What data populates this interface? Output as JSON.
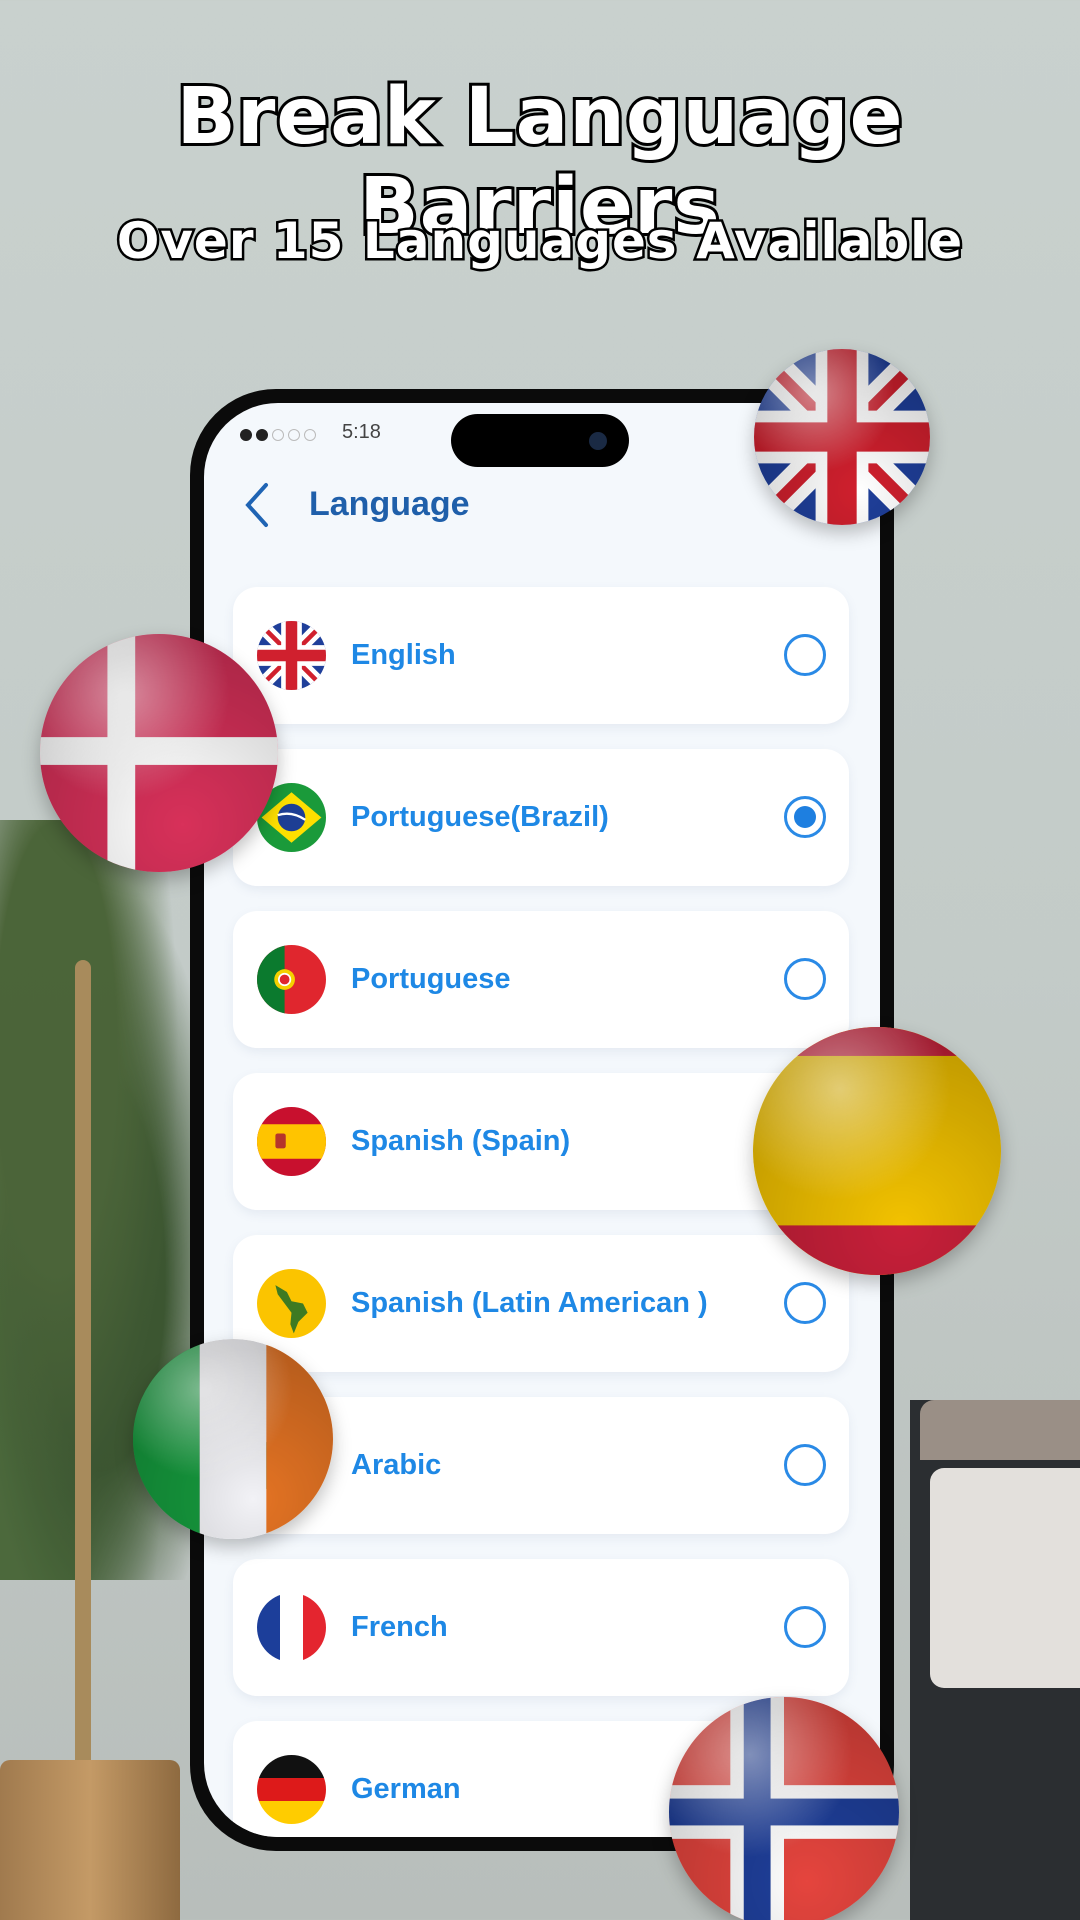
{
  "headline": "Break Language Barriers",
  "subheadline": "Over 15 Languages Available",
  "status_bar": {
    "time": "5:18",
    "signal_bars": 2
  },
  "header": {
    "title": "Language",
    "back_icon": "chevron-left-icon"
  },
  "colors": {
    "accent": "#1e88e5",
    "title": "#1f5faa",
    "background": "#f4f8fc"
  },
  "languages": [
    {
      "label": "English",
      "flag": "uk",
      "selected": false
    },
    {
      "label": "Portuguese(Brazil)",
      "flag": "brazil",
      "selected": true
    },
    {
      "label": "Portuguese",
      "flag": "portugal",
      "selected": false
    },
    {
      "label": "Spanish (Spain)",
      "flag": "spain",
      "selected": false
    },
    {
      "label": "Spanish (Latin American )",
      "flag": "latin-america",
      "selected": false
    },
    {
      "label": "Arabic",
      "flag": "arabic",
      "selected": false
    },
    {
      "label": "French",
      "flag": "france",
      "selected": false
    },
    {
      "label": "German",
      "flag": "germany",
      "selected": false
    }
  ],
  "decorative_flags": [
    "uk",
    "denmark",
    "spain",
    "ireland",
    "norway"
  ]
}
